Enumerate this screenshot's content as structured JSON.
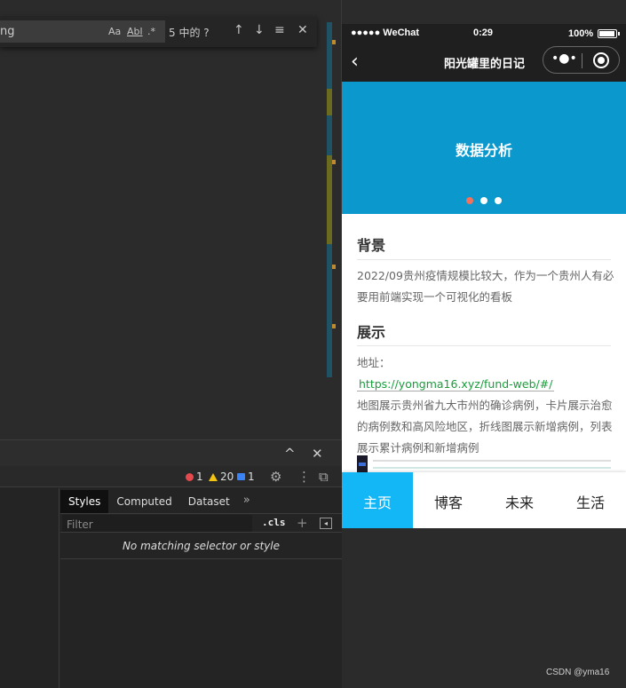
{
  "find": {
    "query": "ng",
    "opt_case": "Aa",
    "opt_word": "Abl",
    "opt_regex": ".*",
    "result_count": "5 中的 ?",
    "prev": "↑",
    "next": "↓",
    "selection": "≡",
    "close": "✕"
  },
  "devtools": {
    "collapse": "^",
    "close": "✕",
    "errors": "1",
    "warnings": "20",
    "messages": "1",
    "settings_icon": "⚙",
    "more_icon": "⋮",
    "dock_icon": "⧉",
    "tabs": [
      "Styles",
      "Computed",
      "Dataset"
    ],
    "more_tabs": "»",
    "filter_placeholder": "Filter",
    "cls": ".cls",
    "add": "+",
    "toggle_sidebar": "◂",
    "no_match": "No matching selector or style"
  },
  "phone": {
    "status": {
      "carrier": "●●●●● WeChat",
      "time": "0:29",
      "battery": "100%"
    },
    "nav": {
      "back": "‹",
      "title": "阳光罐里的日记",
      "menu": "•●•"
    },
    "swiper": {
      "slide_title": "数据分析",
      "active_index": 0,
      "count": 3
    },
    "article": {
      "h1": "背景",
      "p1": "2022/09贵州疫情规模比较大，作为一个贵州人有必要用前端实现一个可视化的看板",
      "h2": "展示",
      "address_label": "地址：",
      "link": "https://yongma16.xyz/fund-web/#/",
      "p2": "地图展示贵州省九大市州的确诊病例，卡片展示治愈的病例数和高风险地区，折线图展示新增病例，列表展示累计病例和新增病例"
    },
    "tabbar": [
      "主页",
      "博客",
      "未来",
      "生活"
    ],
    "active_tab": "主页"
  },
  "watermark": "CSDN @yma16",
  "colors": {
    "swiper_bg": "#0b99cd",
    "tab_active": "#13b7f5",
    "link": "#169e3a",
    "dot_active": "#f0725e"
  }
}
